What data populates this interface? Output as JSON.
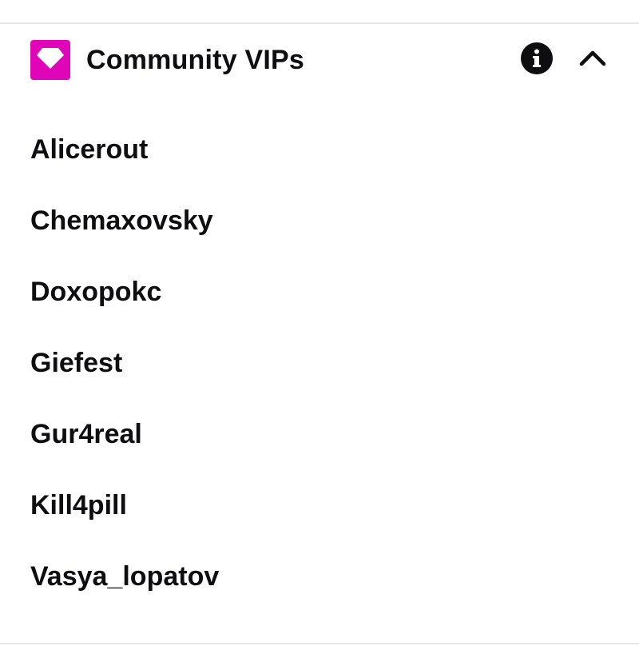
{
  "section": {
    "title": "Community VIPs",
    "badge_icon": "diamond-icon",
    "badge_color": "#e005b9",
    "info_icon": "info-icon",
    "collapse_icon": "chevron-up-icon"
  },
  "vips": [
    {
      "name": "Alicerout"
    },
    {
      "name": "Chemaxovsky"
    },
    {
      "name": "Doxopokc"
    },
    {
      "name": "Giefest"
    },
    {
      "name": "Gur4real"
    },
    {
      "name": "Kill4pill"
    },
    {
      "name": "Vasya_lopatov"
    }
  ]
}
